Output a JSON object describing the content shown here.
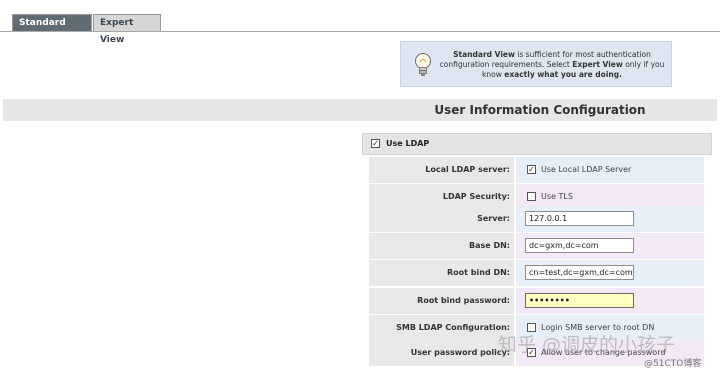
{
  "tabs": [
    {
      "label": "Standard View",
      "active": true
    },
    {
      "label": "Expert View",
      "active": false
    }
  ],
  "info": {
    "p1": "Standard View",
    "p2": " is sufficient for most authentication configuration requirements. Select ",
    "p3": "Expert View",
    "p4": " only if you know ",
    "p5": "exactly what you are doing."
  },
  "section_title": "User Information Configuration",
  "use_ldap": {
    "label": "Use LDAP",
    "checked": true
  },
  "rows": [
    {
      "label": "Local LDAP server:",
      "kind": "checkbox",
      "checked": true,
      "text": "Use Local LDAP Server"
    },
    {
      "label": "LDAP Security:",
      "kind": "checkbox",
      "checked": false,
      "text": "Use TLS"
    },
    {
      "label": "Server:",
      "kind": "input",
      "value": "127.0.0.1"
    },
    {
      "label": "Base DN:",
      "kind": "input",
      "value": "dc=gxm,dc=com"
    },
    {
      "label": "Root bind DN:",
      "kind": "input",
      "value": "cn=test,dc=gxm,dc=com"
    },
    {
      "label": "Root bind password:",
      "kind": "password",
      "value": "••••••••"
    },
    {
      "label": "SMB LDAP Configuration:",
      "kind": "checkbox",
      "checked": false,
      "text": "Login SMB server to root DN"
    },
    {
      "label": "User password policy:",
      "kind": "checkbox",
      "checked": true,
      "text": "Allow user to change password"
    }
  ],
  "watermark": "知乎 @调皮的小孩子",
  "watermark2": "@51CTO博客",
  "colors": {
    "tab_active": "#5f6b75",
    "info_bg": "#dde6f1",
    "row_blue": "#e6eef8",
    "row_pink": "#f3e8f6",
    "password_bg": "#ffffc2"
  }
}
